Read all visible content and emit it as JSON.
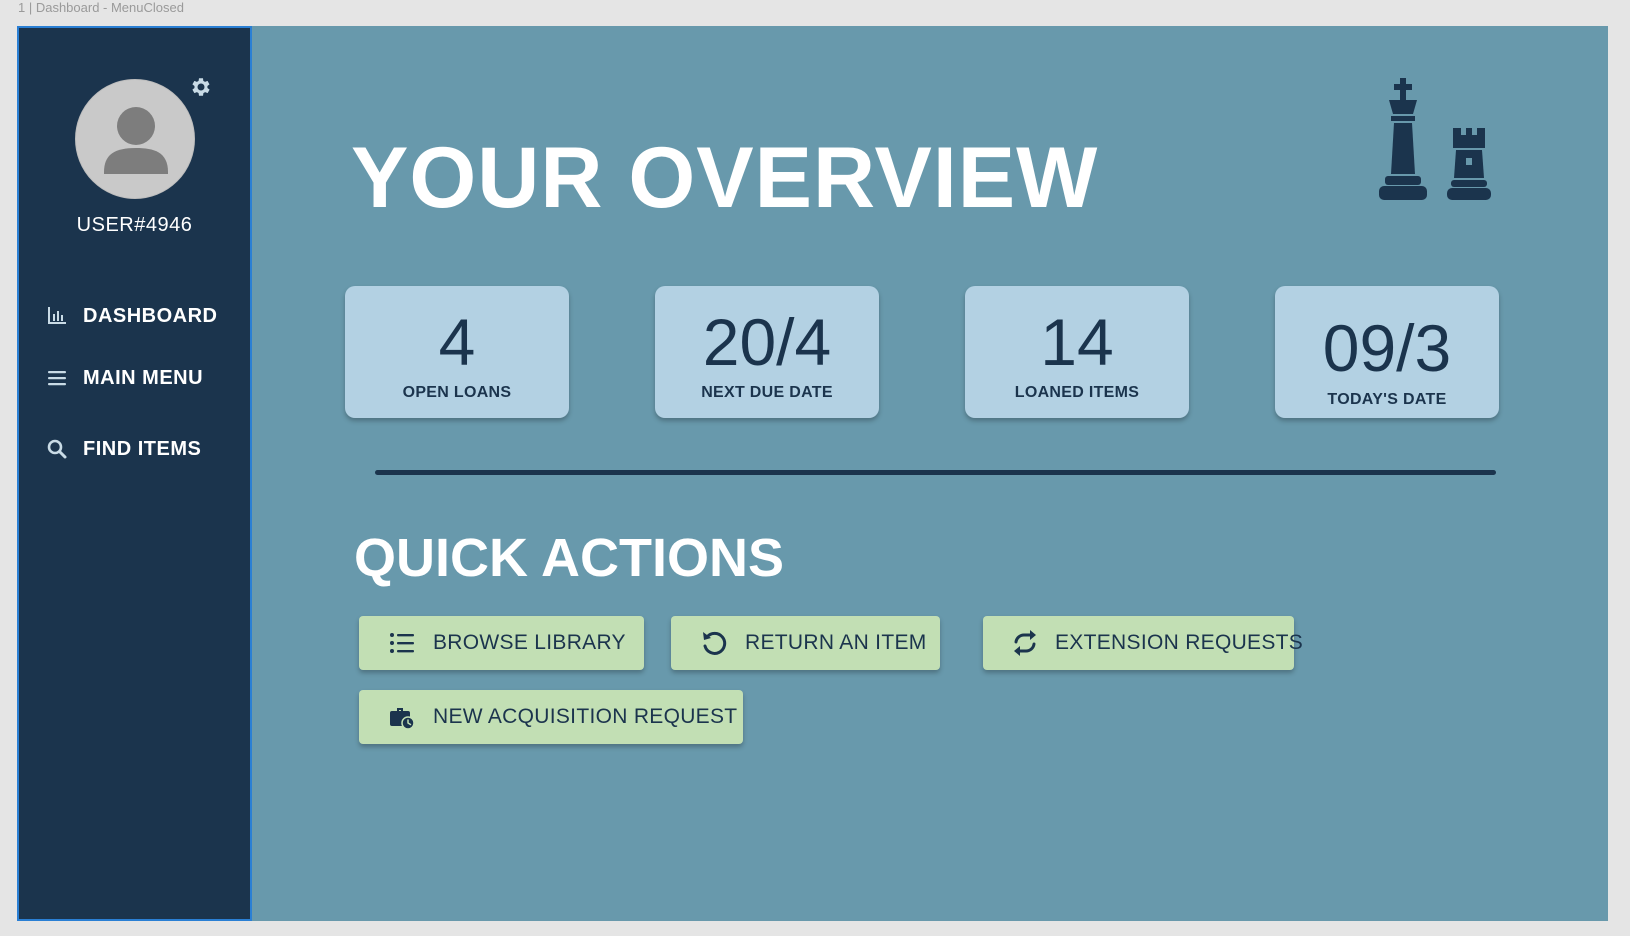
{
  "frame_label": "1 | Dashboard - MenuClosed",
  "colors": {
    "background": "#6899ac",
    "sidebar": "#1b344d",
    "stat_card": "#b3d1e3",
    "action_button": "#c2dfb4",
    "text_dark": "#1b344d",
    "text_light": "#ffffff"
  },
  "sidebar": {
    "username": "USER#4946",
    "avatar_icon": "user-avatar-icon",
    "settings_icon": "gear-icon",
    "items": [
      {
        "label": "DASHBOARD",
        "icon": "bar-chart-icon"
      },
      {
        "label": "MAIN MENU",
        "icon": "hamburger-icon"
      },
      {
        "label": "FIND ITEMS",
        "icon": "search-icon"
      }
    ]
  },
  "main": {
    "title": "YOUR OVERVIEW",
    "decor_icon": "chess-king-rook-icon",
    "stats": [
      {
        "value": "4",
        "label": "OPEN LOANS"
      },
      {
        "value": "20/4",
        "label": "NEXT DUE DATE"
      },
      {
        "value": "14",
        "label": "LOANED ITEMS"
      },
      {
        "value": "09/3",
        "label": "TODAY'S DATE"
      }
    ],
    "quick_actions_title": "QUICK ACTIONS",
    "actions": [
      {
        "label": "BROWSE LIBRARY",
        "icon": "list-icon"
      },
      {
        "label": "RETURN AN ITEM",
        "icon": "undo-icon"
      },
      {
        "label": "EXTENSION REQUESTS",
        "icon": "repeat-icon"
      },
      {
        "label": "NEW ACQUISITION REQUEST",
        "icon": "briefcase-clock-icon"
      }
    ]
  }
}
